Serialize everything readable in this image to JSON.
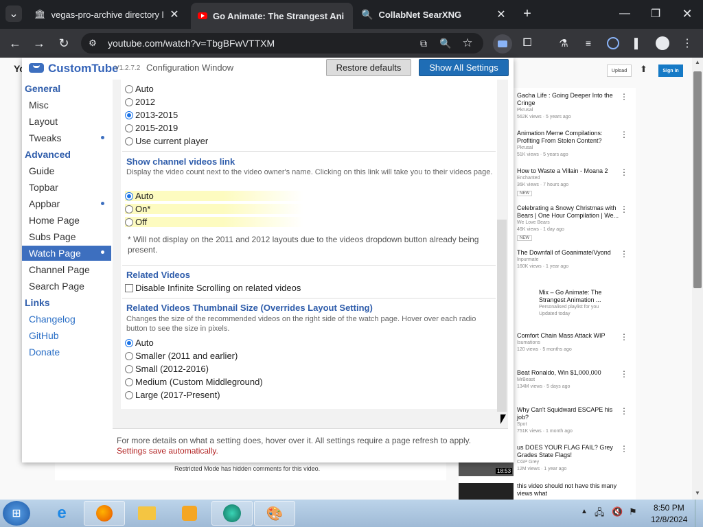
{
  "tabs": [
    {
      "title": "vegas-pro-archive directory lis",
      "icon": "archive-icon"
    },
    {
      "title": "Go Animate: The Strangest Ani",
      "icon": "youtube-icon"
    },
    {
      "title": "CollabNet SearXNG",
      "icon": "search-icon"
    }
  ],
  "address": "youtube.com/watch?v=TbgBFwVTTXM",
  "youtube": {
    "upload": "Upload",
    "sign_in": "Sign in",
    "restricted_notice": "Restricted Mode has hidden comments for this video.",
    "related": [
      {
        "title": "Gacha Life : Going Deeper Into the Cringe",
        "channel": "Pkrusal",
        "meta": "562K views · 5 years ago"
      },
      {
        "title": "Animation Meme Compilations: Profiting From Stolen Content?",
        "channel": "Pkrusal",
        "meta": "51K views · 5 years ago"
      },
      {
        "title": "How to Waste a Villain - Moana 2",
        "channel": "Enchanted",
        "meta": "36K views · 7 hours ago",
        "badge": "NEW"
      },
      {
        "title": "Celebrating a Snowy Christmas with Bears | One Hour Compilation | We...",
        "channel": "We Love Bears",
        "meta": "46K views · 1 day ago",
        "badge": "NEW"
      },
      {
        "title": "The Downfall of Goanimate/Vyond",
        "channel": "Inpurmate",
        "meta": "160K views · 1 year ago"
      },
      {
        "title": "Mix – Go Animate: The Strangest Animation ...",
        "channel": "Personalised playlist for you",
        "meta": "Updated today"
      },
      {
        "title": "Comfort Chain Mass Attack WIP",
        "channel": "Isumations",
        "meta": "120 views · 5 months ago"
      },
      {
        "title": "Beat Ronaldo, Win $1,000,000",
        "channel": "MrBeast",
        "meta": "134M views · 5 days ago"
      },
      {
        "title": "Why Can't Squidward ESCAPE his job?",
        "channel": "Spot",
        "meta": "751K views · 1 month ago"
      },
      {
        "title": "us DOES YOUR FLAG FAIL? Grey Grades State Flags!",
        "channel": "CGP Grey",
        "meta": "12M views · 1 year ago",
        "duration": "18:53"
      },
      {
        "title": "this video should not have this many views what",
        "channel": "",
        "meta": ""
      }
    ]
  },
  "ext": {
    "brand_custom": "Custom",
    "brand_tube": "Tube",
    "version": "V1.2.7.2",
    "window_title": "Configuration Window",
    "restore_label": "Restore defaults",
    "show_all_label": "Show All Settings",
    "nav": {
      "general": "General",
      "misc": "Misc",
      "layout": "Layout",
      "tweaks": "Tweaks",
      "advanced": "Advanced",
      "guide": "Guide",
      "topbar": "Topbar",
      "appbar": "Appbar",
      "home": "Home Page",
      "subs": "Subs Page",
      "watch": "Watch Page",
      "channel": "Channel Page",
      "search": "Search Page",
      "links": "Links",
      "changelog": "Changelog",
      "github": "GitHub",
      "donate": "Donate"
    },
    "layout_options": [
      "Auto",
      "2012",
      "2013-2015",
      "2015-2019",
      "Use current player"
    ],
    "layout_selected": "2013-2015",
    "channel_link": {
      "heading": "Show channel videos link",
      "desc": "Display the video count next to the video owner's name. Clicking on this link will take you to their videos page.",
      "options": [
        "Auto",
        "On*",
        "Off"
      ],
      "selected": "Auto",
      "note": "* Will not display on the 2011 and 2012 layouts due to the videos dropdown button already being present."
    },
    "related_videos": {
      "heading": "Related Videos",
      "checkbox": "Disable Infinite Scrolling on related videos",
      "checked": false
    },
    "thumb_size": {
      "heading": "Related Videos Thumbnail Size (Overrides Layout Setting)",
      "desc": "Changes the size of the recommended videos on the right side of the watch page. Hover over each radio button to see the size in pixels.",
      "options": [
        "Auto",
        "Smaller (2011 and earlier)",
        "Small (2012-2016)",
        "Medium (Custom Middleground)",
        "Large (2017-Present)"
      ],
      "selected": "Auto"
    },
    "footer_info": "For more details on what a setting does, hover over it. All settings require a page refresh to apply.",
    "footer_save": "Settings save automatically."
  },
  "taskbar": {
    "time": "8:50 PM",
    "date": "12/8/2024"
  },
  "colors": {
    "accent": "#3d6fbf",
    "show_all_bg": "#1f6db5",
    "highlight": "#fdfbc0",
    "save_text": "#b22222"
  }
}
